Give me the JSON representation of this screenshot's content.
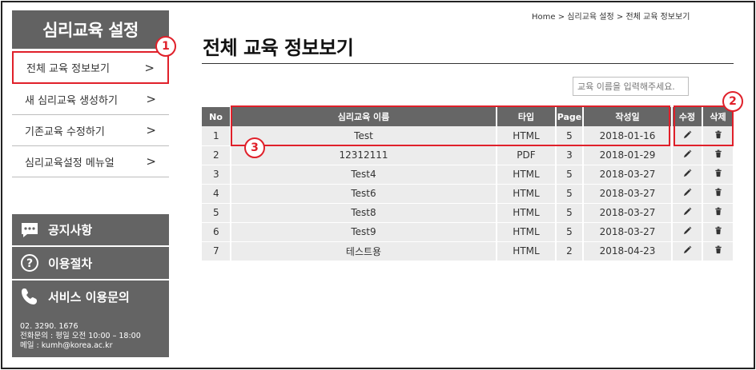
{
  "sidebar": {
    "title": "심리교육 설정",
    "menu": [
      {
        "label": "전체 교육 정보보기"
      },
      {
        "label": "새 심리교육 생성하기"
      },
      {
        "label": "기존교육 수정하기"
      },
      {
        "label": "심리교육설정 메뉴얼"
      }
    ],
    "chevron": ">",
    "notice_label": "공지사항",
    "process_label": "이용절차",
    "service_label": "서비스 이용문의",
    "phone": "02. 3290. 1676",
    "hours": "전화문의 : 평일 오전 10:00 – 18:00",
    "email": "메일 : kumh@korea.ac.kr"
  },
  "breadcrumb": {
    "home": "Home",
    "sep": ">",
    "level1": "심리교육 설정",
    "level2": "전체 교육 정보보기"
  },
  "page": {
    "title": "전체 교육 정보보기"
  },
  "search": {
    "placeholder": "교육 이름을 입력해주세요."
  },
  "table": {
    "headers": {
      "no": "No",
      "name": "심리교육 이름",
      "type": "타입",
      "page": "Page",
      "date": "작성일",
      "edit": "수정",
      "delete": "삭제"
    },
    "rows": [
      {
        "no": "1",
        "name": "Test",
        "type": "HTML",
        "page": "5",
        "date": "2018-01-16"
      },
      {
        "no": "2",
        "name": "12312111",
        "type": "PDF",
        "page": "3",
        "date": "2018-01-29"
      },
      {
        "no": "3",
        "name": "Test4",
        "type": "HTML",
        "page": "5",
        "date": "2018-03-27"
      },
      {
        "no": "4",
        "name": "Test6",
        "type": "HTML",
        "page": "5",
        "date": "2018-03-27"
      },
      {
        "no": "5",
        "name": "Test8",
        "type": "HTML",
        "page": "5",
        "date": "2018-03-27"
      },
      {
        "no": "6",
        "name": "Test9",
        "type": "HTML",
        "page": "5",
        "date": "2018-03-27"
      },
      {
        "no": "7",
        "name": "테스트용",
        "type": "HTML",
        "page": "2",
        "date": "2018-04-23"
      }
    ]
  },
  "callouts": {
    "one": "1",
    "two": "2",
    "three": "3"
  },
  "colors": {
    "sidebar_dark": "#626262",
    "accent_red": "#e0202a",
    "row_bg": "#ececec"
  },
  "icons": {
    "edit": "pencil-icon",
    "delete": "trash-icon",
    "notice": "chat-bubble-icon",
    "process": "question-circle-icon",
    "service": "phone-icon"
  }
}
